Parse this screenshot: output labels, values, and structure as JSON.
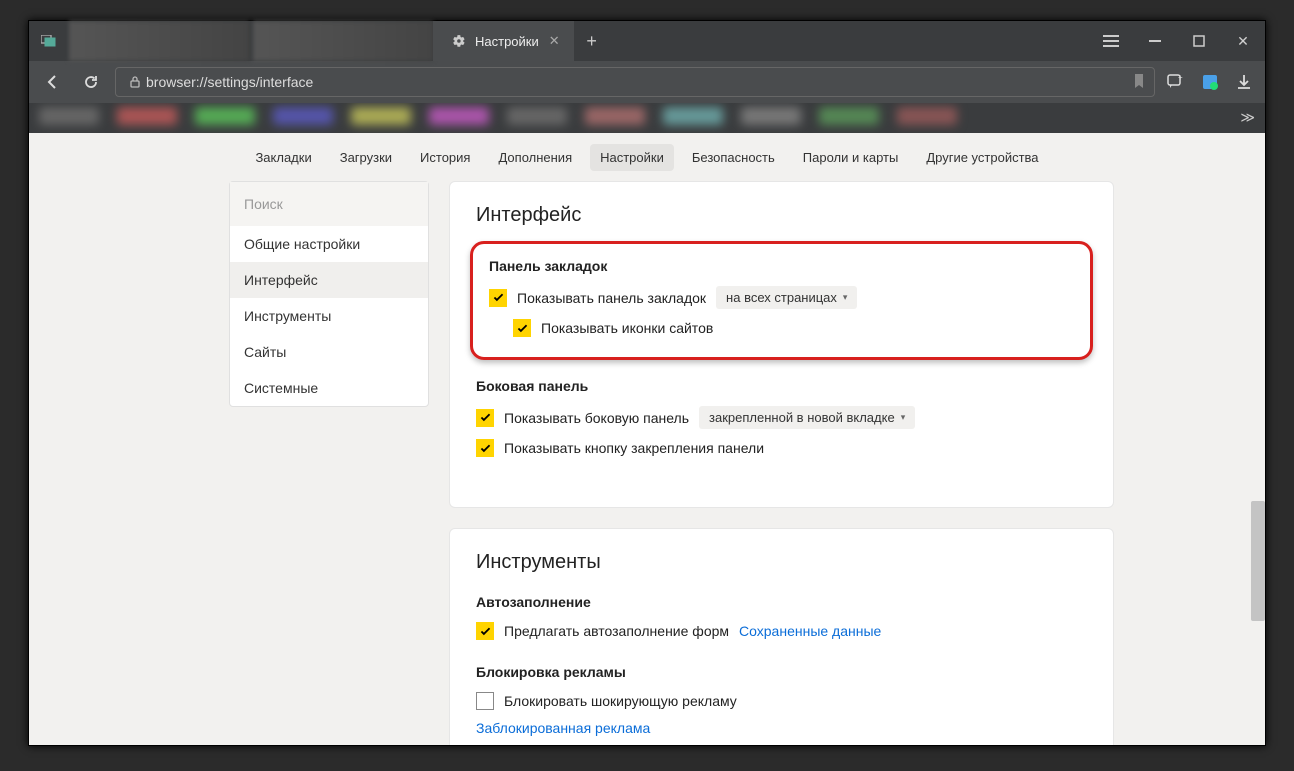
{
  "titlebar": {
    "active_tab_label": "Настройки"
  },
  "navbar": {
    "url": "browser://settings/interface"
  },
  "topnav": {
    "items": [
      "Закладки",
      "Загрузки",
      "История",
      "Дополнения",
      "Настройки",
      "Безопасность",
      "Пароли и карты",
      "Другие устройства"
    ],
    "selected": 4
  },
  "sidebar": {
    "search_placeholder": "Поиск",
    "items": [
      "Общие настройки",
      "Интерфейс",
      "Инструменты",
      "Сайты",
      "Системные"
    ],
    "selected": 1
  },
  "panel_interface": {
    "title": "Интерфейс",
    "bookmarks_panel": {
      "heading": "Панель закладок",
      "show_panel_label": "Показывать панель закладок",
      "show_panel_dropdown": "на всех страницах",
      "show_icons_label": "Показывать иконки сайтов"
    },
    "side_panel": {
      "heading": "Боковая панель",
      "show_side_label": "Показывать боковую панель",
      "show_side_dropdown": "закрепленной в новой вкладке",
      "show_pin_label": "Показывать кнопку закрепления панели"
    }
  },
  "panel_tools": {
    "title": "Инструменты",
    "autofill": {
      "heading": "Автозаполнение",
      "suggest_label": "Предлагать автозаполнение форм",
      "saved_data_link": "Сохраненные данные"
    },
    "adblock": {
      "heading": "Блокировка рекламы",
      "block_label": "Блокировать шокирующую рекламу",
      "blocked_link": "Заблокированная реклама"
    }
  }
}
